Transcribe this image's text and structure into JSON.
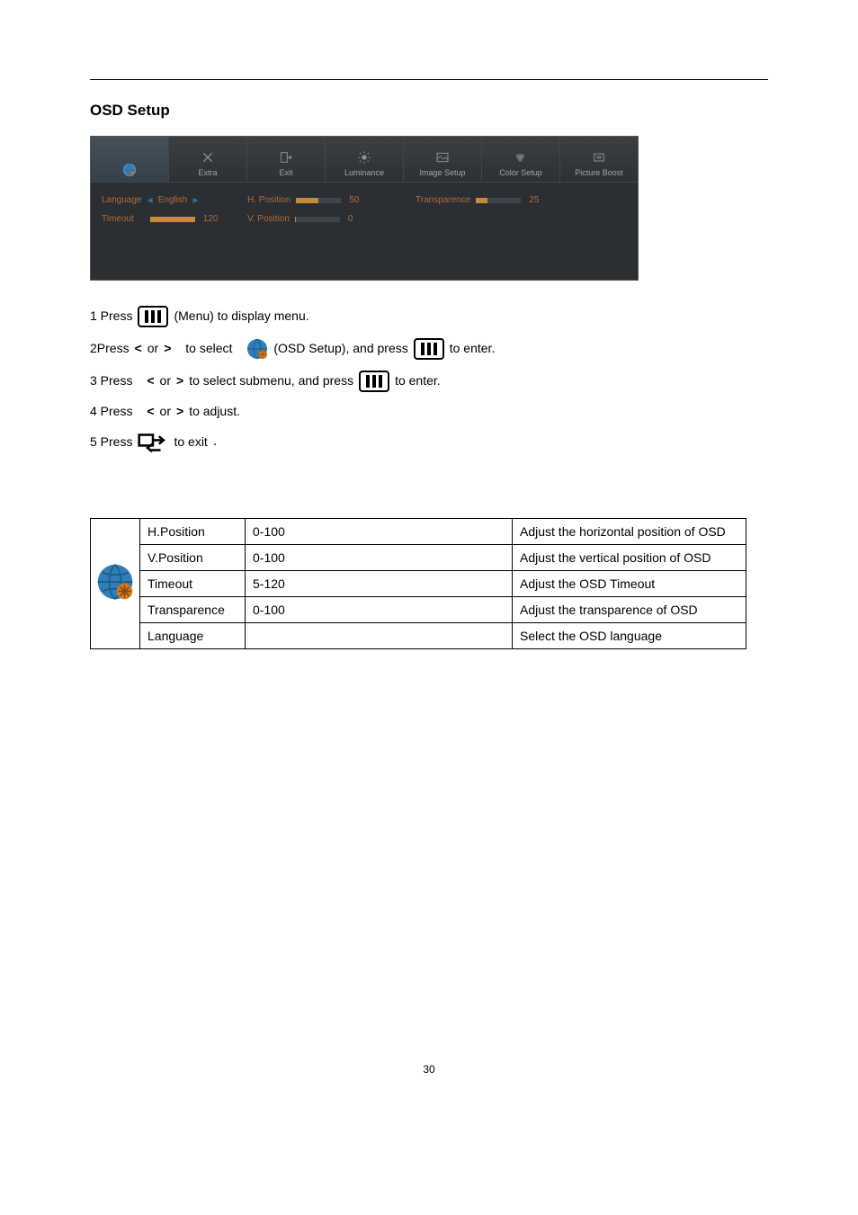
{
  "title": "OSD Setup",
  "osd": {
    "tabs": {
      "extra": "Extra",
      "exit": "Exit",
      "luminance": "Luminance",
      "image_setup": "Image Setup",
      "color_setup": "Color Setup",
      "picture_boost": "Picture Boost"
    },
    "rows": {
      "language_label": "Language",
      "language_value": "English",
      "timeout_label": "Timeout",
      "timeout_value": "120",
      "hpos_label": "H. Position",
      "hpos_value": "50",
      "vpos_label": "V. Position",
      "vpos_value": "0",
      "transp_label": "Transparence",
      "transp_value": "25"
    }
  },
  "steps": {
    "s1a": "1 Press",
    "s1b": "(Menu) to display menu.",
    "s2a": "2Press",
    "s2b": "or",
    "s2c": "to select",
    "s2d": "(OSD Setup), and press",
    "s2e": "to enter.",
    "s3a": "3 Press",
    "s3b": "or",
    "s3c": "to select submenu, and press",
    "s3d": "to enter.",
    "s4a": "4 Press",
    "s4b": "or",
    "s4c": "to adjust.",
    "s5a": "5 Press",
    "s5b": "to exit",
    "s5c": ".",
    "lt": "<",
    "gt": ">"
  },
  "table": [
    {
      "name": "H.Position",
      "range": "0-100",
      "desc": "Adjust the horizontal position of OSD"
    },
    {
      "name": "V.Position",
      "range": "0-100",
      "desc": "Adjust the vertical position of OSD"
    },
    {
      "name": "Timeout",
      "range": "5-120",
      "desc": "Adjust the OSD Timeout"
    },
    {
      "name": "Transparence",
      "range": "0-100",
      "desc": "Adjust the transparence of OSD"
    },
    {
      "name": "Language",
      "range": "",
      "desc": "Select the OSD language"
    }
  ],
  "page_number": "30"
}
